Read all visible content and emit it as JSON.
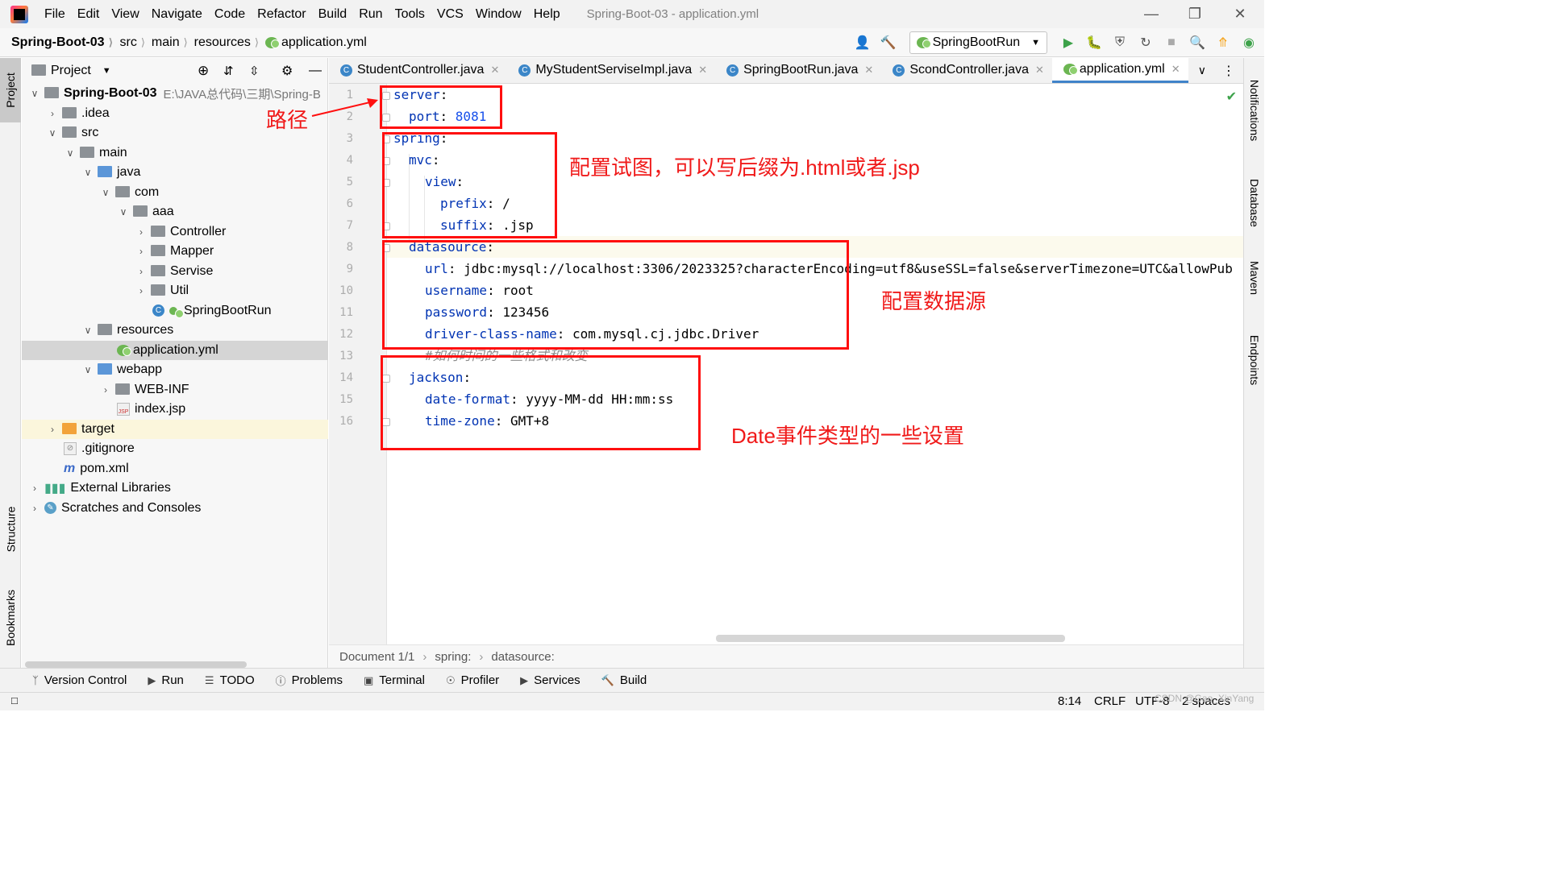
{
  "app": {
    "window_title": "Spring-Boot-03 - application.yml",
    "menu": [
      "File",
      "Edit",
      "View",
      "Navigate",
      "Code",
      "Refactor",
      "Build",
      "Run",
      "Tools",
      "VCS",
      "Window",
      "Help"
    ]
  },
  "navbar": {
    "breadcrumbs": [
      "Spring-Boot-03",
      "src",
      "main",
      "resources",
      "application.yml"
    ],
    "run_config": "SpringBootRun"
  },
  "left_strip": {
    "project_tab": "Project",
    "structure_tab": "Structure",
    "bookmarks_tab": "Bookmarks"
  },
  "right_strip": {
    "notifications": "Notifications",
    "database": "Database",
    "maven": "Maven",
    "endpoints": "Endpoints"
  },
  "project_panel": {
    "title": "Project",
    "tree": [
      {
        "label": "Spring-Boot-03",
        "path": "E:\\JAVA总代码\\三期\\Spring-B",
        "level": 0,
        "expanded": true,
        "icon": "module-folder-icon"
      },
      {
        "label": ".idea",
        "level": 1,
        "expanded": false,
        "icon": "folder-icon"
      },
      {
        "label": "src",
        "level": 1,
        "expanded": true,
        "icon": "folder-icon"
      },
      {
        "label": "main",
        "level": 2,
        "expanded": true,
        "icon": "folder-icon"
      },
      {
        "label": "java",
        "level": 3,
        "expanded": true,
        "icon": "source-folder-icon"
      },
      {
        "label": "com",
        "level": 4,
        "expanded": true,
        "icon": "package-icon"
      },
      {
        "label": "aaa",
        "level": 5,
        "expanded": true,
        "icon": "package-icon"
      },
      {
        "label": "Controller",
        "level": 6,
        "expanded": false,
        "icon": "package-icon"
      },
      {
        "label": "Mapper",
        "level": 6,
        "expanded": false,
        "icon": "package-icon"
      },
      {
        "label": "Servise",
        "level": 6,
        "expanded": false,
        "icon": "package-icon"
      },
      {
        "label": "Util",
        "level": 6,
        "expanded": false,
        "icon": "package-icon"
      },
      {
        "label": "SpringBootRun",
        "level": 7,
        "icon": "spring-class-icon"
      },
      {
        "label": "resources",
        "level": 3,
        "expanded": true,
        "icon": "resources-folder-icon"
      },
      {
        "label": "application.yml",
        "level": 5,
        "icon": "yml-file-icon",
        "selected": true
      },
      {
        "label": "webapp",
        "level": 3,
        "expanded": true,
        "icon": "web-folder-icon"
      },
      {
        "label": "WEB-INF",
        "level": 4,
        "expanded": false,
        "icon": "folder-icon"
      },
      {
        "label": "index.jsp",
        "level": 5,
        "icon": "jsp-file-icon"
      },
      {
        "label": "target",
        "level": 1,
        "expanded": false,
        "icon": "excluded-folder-icon"
      },
      {
        "label": ".gitignore",
        "level": 2,
        "icon": "gitignore-icon"
      },
      {
        "label": "pom.xml",
        "level": 2,
        "icon": "maven-icon"
      },
      {
        "label": "External Libraries",
        "level": 0,
        "expanded": false,
        "icon": "libraries-icon"
      },
      {
        "label": "Scratches and Consoles",
        "level": 0,
        "expanded": false,
        "icon": "scratches-icon"
      }
    ]
  },
  "editor_tabs": [
    {
      "label": "StudentController.java",
      "active": false
    },
    {
      "label": "MyStudentServiseImpl.java",
      "active": false
    },
    {
      "label": "SpringBootRun.java",
      "active": false
    },
    {
      "label": "ScondController.java",
      "active": false
    },
    {
      "label": "application.yml",
      "active": true
    }
  ],
  "editor": {
    "lines": [
      {
        "n": "1",
        "key": "server",
        "sep": ":",
        "val": ""
      },
      {
        "n": "2",
        "key": "port",
        "sep": ": ",
        "val": "8081"
      },
      {
        "n": "3",
        "key": "spring",
        "sep": ":",
        "val": ""
      },
      {
        "n": "4",
        "key": "mvc",
        "sep": ":",
        "val": ""
      },
      {
        "n": "5",
        "key": "view",
        "sep": ":",
        "val": ""
      },
      {
        "n": "6",
        "key": "prefix",
        "sep": ": ",
        "val": "/"
      },
      {
        "n": "7",
        "key": "suffix",
        "sep": ": ",
        "val": ".jsp"
      },
      {
        "n": "8",
        "key": "datasource",
        "sep": ":",
        "val": ""
      },
      {
        "n": "9",
        "key": "url",
        "sep": ": ",
        "val": "jdbc:mysql://localhost:3306/2023325?characterEncoding=utf8&useSSL=false&serverTimezone=UTC&allowPub"
      },
      {
        "n": "10",
        "key": "username",
        "sep": ": ",
        "val": "root"
      },
      {
        "n": "11",
        "key": "password",
        "sep": ": ",
        "val": "123456"
      },
      {
        "n": "12",
        "key": "driver-class-name",
        "sep": ": ",
        "val": "com.mysql.cj.jdbc.Driver"
      },
      {
        "n": "13",
        "comment": "#如何时间的一些格式和改变"
      },
      {
        "n": "14",
        "key": "jackson",
        "sep": ":",
        "val": ""
      },
      {
        "n": "15",
        "key": "date-format",
        "sep": ": ",
        "val": "yyyy-MM-dd HH:mm:ss"
      },
      {
        "n": "16",
        "key": "time-zone",
        "sep": ": ",
        "val": "GMT+8"
      }
    ]
  },
  "annotations": {
    "path": "路径",
    "view": "配置试图，可以写后缀为.html或者.jsp",
    "datasource": "配置数据源",
    "date": "Date事件类型的一些设置"
  },
  "editor_breadcrumb": [
    "Document 1/1",
    "spring:",
    "datasource:"
  ],
  "bottom_tools": [
    "Version Control",
    "Run",
    "TODO",
    "Problems",
    "Terminal",
    "Profiler",
    "Services",
    "Build"
  ],
  "statusbar": {
    "position": "8:14",
    "line_sep": "CRLF",
    "encoding": "UTF-8",
    "indent": "2 spaces",
    "watermark": "CSDN @Gao_XinYang"
  },
  "colors": {
    "yaml_key": "#0033b3",
    "number": "#1750eb",
    "annotation_red": "#ff0f0f",
    "active_tab_underline": "#4083c9"
  }
}
